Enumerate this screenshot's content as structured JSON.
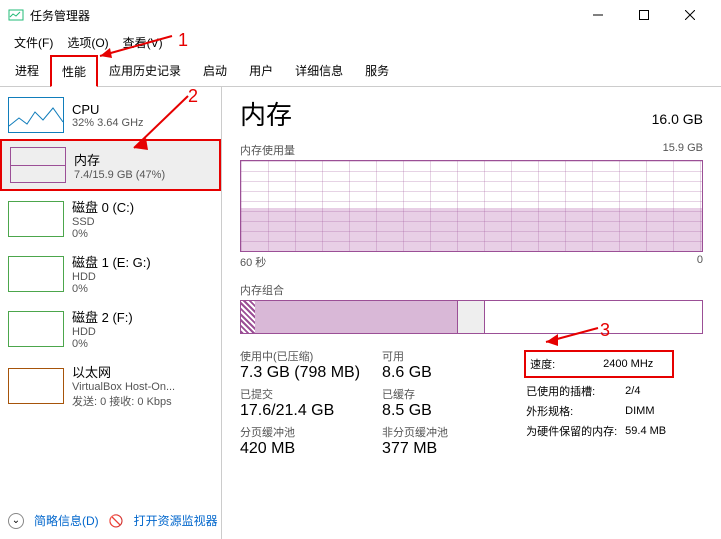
{
  "window": {
    "title": "任务管理器"
  },
  "menu": {
    "file": "文件(F)",
    "options": "选项(O)",
    "view": "查看(V)"
  },
  "tabs": [
    "进程",
    "性能",
    "应用历史记录",
    "启动",
    "用户",
    "详细信息",
    "服务"
  ],
  "sidebar": {
    "cpu": {
      "title": "CPU",
      "sub": "32% 3.64 GHz"
    },
    "mem": {
      "title": "内存",
      "sub": "7.4/15.9 GB (47%)"
    },
    "disk0": {
      "title": "磁盘 0 (C:)",
      "sub1": "SSD",
      "sub2": "0%"
    },
    "disk1": {
      "title": "磁盘 1 (E: G:)",
      "sub1": "HDD",
      "sub2": "0%"
    },
    "disk2": {
      "title": "磁盘 2 (F:)",
      "sub1": "HDD",
      "sub2": "0%"
    },
    "eth": {
      "title": "以太网",
      "sub1": "VirtualBox Host-On...",
      "sub2": "发送: 0 接收: 0 Kbps"
    }
  },
  "main": {
    "title": "内存",
    "total": "16.0 GB",
    "usage_label": "内存使用量",
    "usage_max": "15.9 GB",
    "axis_left": "60 秒",
    "axis_right": "0",
    "comp_label": "内存组合",
    "stats": {
      "inuse_label": "使用中(已压缩)",
      "inuse_val": "7.3 GB (798 MB)",
      "avail_label": "可用",
      "avail_val": "8.6 GB",
      "commit_label": "已提交",
      "commit_val": "17.6/21.4 GB",
      "cached_label": "已缓存",
      "cached_val": "8.5 GB",
      "paged_label": "分页缓冲池",
      "paged_val": "420 MB",
      "nonpaged_label": "非分页缓冲池",
      "nonpaged_val": "377 MB"
    },
    "props": {
      "speed_k": "速度:",
      "speed_v": "2400 MHz",
      "slots_k": "已使用的插槽:",
      "slots_v": "2/4",
      "form_k": "外形规格:",
      "form_v": "DIMM",
      "hw_k": "为硬件保留的内存:",
      "hw_v": "59.4 MB"
    }
  },
  "footer": {
    "less": "简略信息(D)",
    "resmon": "打开资源监视器"
  },
  "annotations": {
    "n1": "1",
    "n2": "2",
    "n3": "3"
  }
}
